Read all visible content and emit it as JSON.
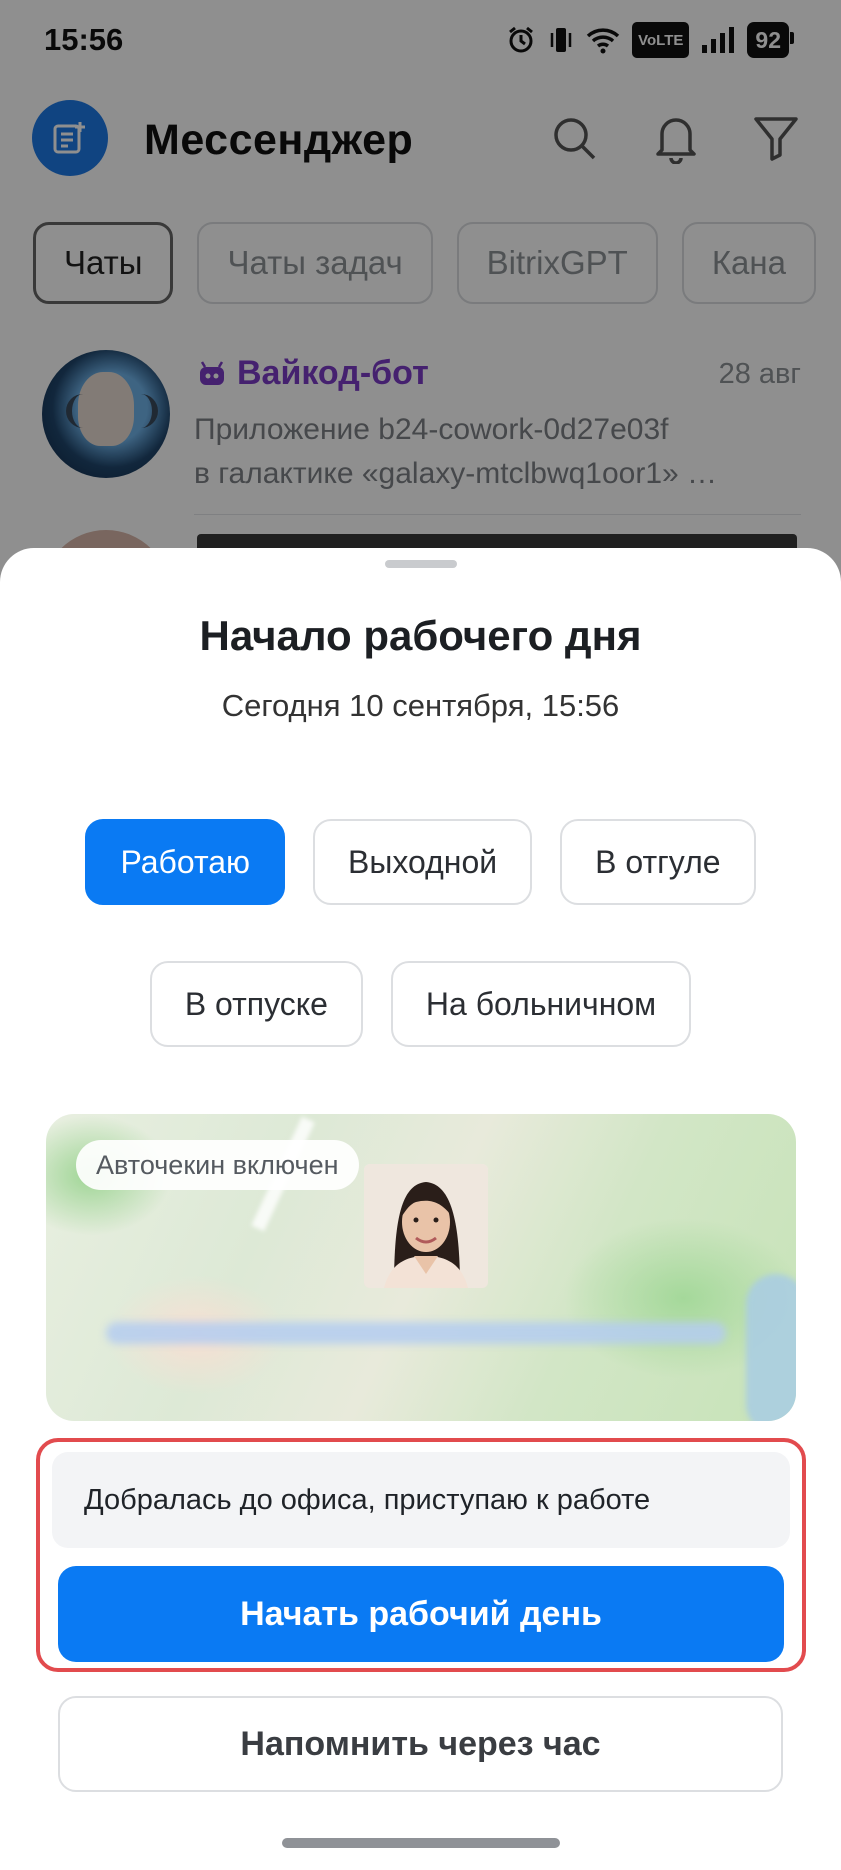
{
  "statusbar": {
    "time": "15:56",
    "volte": "VoLTE",
    "battery": "92"
  },
  "app": {
    "title": "Мессенджер",
    "tabs": [
      {
        "label": "Чаты",
        "active": true
      },
      {
        "label": "Чаты задач",
        "active": false
      },
      {
        "label": "BitrixGPT",
        "active": false
      },
      {
        "label": "Кана",
        "active": false
      }
    ],
    "chat": {
      "name": "Вайкод-бот",
      "date": "28 авг",
      "preview_line1": "Приложение b24-cowork-0d27e03f",
      "preview_line2": "в галактике «galaxy-mtclbwq1oor1» …"
    }
  },
  "sheet": {
    "title": "Начало рабочего дня",
    "subtitle": "Сегодня 10 сентября, 15:56",
    "statuses": [
      {
        "label": "Работаю",
        "selected": true
      },
      {
        "label": "Выходной",
        "selected": false
      },
      {
        "label": "В отгуле",
        "selected": false
      },
      {
        "label": "В отпуске",
        "selected": false
      },
      {
        "label": "На больничном",
        "selected": false
      }
    ],
    "map": {
      "badge": "Авточекин включен"
    },
    "comment_value": "Добралась до офиса, приступаю к работе",
    "start_button": "Начать рабочий день",
    "remind_button": "Напомнить через час"
  },
  "colors": {
    "accent": "#0a7af3",
    "highlight": "#e24b4e",
    "bot_name": "#7b3bc7"
  }
}
